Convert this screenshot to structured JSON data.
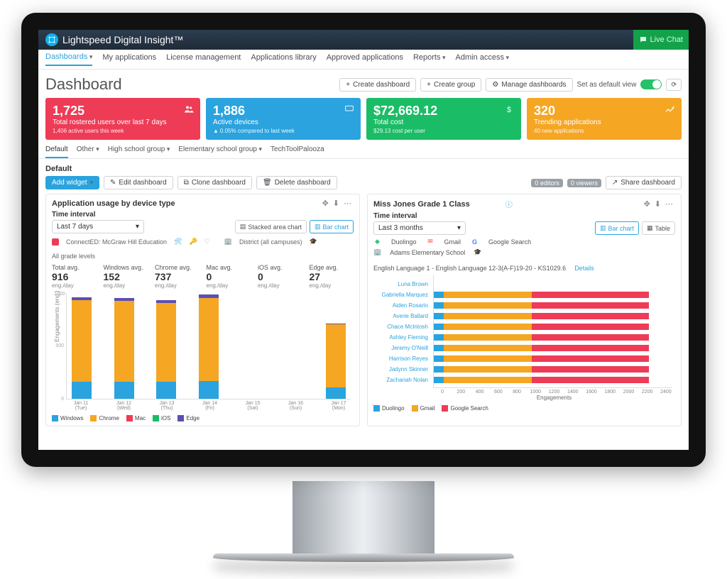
{
  "brand": "Lightspeed Digital Insight™",
  "live_chat": "Live Chat",
  "nav": [
    "Dashboards",
    "My applications",
    "License management",
    "Applications library",
    "Approved applications",
    "Reports",
    "Admin access"
  ],
  "page_title": "Dashboard",
  "actions": {
    "create_dashboard": "Create dashboard",
    "create_group": "Create group",
    "manage_dashboards": "Manage dashboards",
    "set_default": "Set as default view"
  },
  "kpis": [
    {
      "value": "1,725",
      "label": "Total rostered users over last 7 days",
      "sub": "1,406 active users this week"
    },
    {
      "value": "1,886",
      "label": "Active devices",
      "sub": "0.05% compared to last week"
    },
    {
      "value": "$72,669.12",
      "label": "Total cost",
      "sub": "$29.13 cost per user"
    },
    {
      "value": "320",
      "label": "Trending applications",
      "sub": "40 new applications"
    }
  ],
  "group_tabs": [
    "Default",
    "Other",
    "High school group",
    "Elementary school group",
    "TechToolPalooza"
  ],
  "section_label": "Default",
  "toolbar": {
    "add_widget": "Add widget",
    "edit": "Edit dashboard",
    "clone": "Clone dashboard",
    "delete": "Delete dashboard",
    "editors": "0 editors",
    "viewers": "0 viewers",
    "share": "Share dashboard"
  },
  "panel_left": {
    "title": "Application usage by device type",
    "time_label": "Time interval",
    "time_value": "Last 7 days",
    "view_stacked": "Stacked area chart",
    "view_bar": "Bar chart",
    "filter_app": "ConnectED: McGraw Hill Education",
    "filter_district": "District (all campuses)",
    "filter_grade": "All grade levels",
    "stats": [
      {
        "title": "Total avg.",
        "value": "916",
        "unit": "eng./day"
      },
      {
        "title": "Windows avg.",
        "value": "152",
        "unit": "eng./day"
      },
      {
        "title": "Chrome avg.",
        "value": "737",
        "unit": "eng./day"
      },
      {
        "title": "Mac avg.",
        "value": "0",
        "unit": "eng./day"
      },
      {
        "title": "iOS avg.",
        "value": "0",
        "unit": "eng./day"
      },
      {
        "title": "Edge avg.",
        "value": "27",
        "unit": "eng./day"
      }
    ],
    "ylabel": "Engagements (eng.)",
    "legend": [
      "Windows",
      "Chrome",
      "Mac",
      "iOS",
      "Edge"
    ]
  },
  "panel_right": {
    "title": "Miss Jones Grade 1 Class",
    "time_label": "Time interval",
    "time_value": "Last 3 months",
    "view_bar": "Bar chart",
    "view_table": "Table",
    "apps": [
      "Duolingo",
      "Gmail",
      "Google Search"
    ],
    "school": "Adams Elementary School",
    "course": "English Language 1 - English Language 12-3(A-F)19-20 - KS1029.6",
    "details": "Details",
    "xlabel": "Engagements"
  },
  "chart_data": [
    {
      "type": "bar",
      "panel": "left",
      "stacked": true,
      "categories": [
        "Jan 11 (Tue)",
        "Jan 12 (Wed)",
        "Jan 13 (Thu)",
        "Jan 14 (Fri)",
        "Jan 15 (Sat)",
        "Jan 16 (Sun)",
        "Jan 17 (Mon)"
      ],
      "series": [
        {
          "name": "Windows",
          "color": "#2aa3df",
          "values": [
            160,
            160,
            160,
            170,
            0,
            0,
            110
          ]
        },
        {
          "name": "Chrome",
          "color": "#f5a623",
          "values": [
            770,
            760,
            740,
            780,
            0,
            0,
            590
          ]
        },
        {
          "name": "Mac",
          "color": "#ee3b56",
          "values": [
            0,
            0,
            0,
            0,
            0,
            0,
            0
          ]
        },
        {
          "name": "iOS",
          "color": "#1bbc66",
          "values": [
            0,
            0,
            0,
            0,
            0,
            0,
            0
          ]
        },
        {
          "name": "Edge",
          "color": "#5a4fb5",
          "values": [
            25,
            30,
            25,
            30,
            0,
            0,
            10
          ]
        }
      ],
      "ylim": [
        0,
        1000
      ],
      "ylabel": "Engagements (eng.)"
    },
    {
      "type": "bar",
      "panel": "right",
      "orientation": "horizontal",
      "stacked": true,
      "categories": [
        "Luna Brown",
        "Gabriella Marquez",
        "Aiden Rosario",
        "Averie Ballard",
        "Chace McIntosh",
        "Ashley Fleming",
        "Jeremy O'Neill",
        "Harrison Reyes",
        "Jadynn Skinner",
        "Zachariah Nolan"
      ],
      "series": [
        {
          "name": "Duolingo",
          "color": "#2aa3df",
          "values": [
            0,
            100,
            100,
            100,
            100,
            100,
            100,
            100,
            100,
            100
          ]
        },
        {
          "name": "Gmail",
          "color": "#f5a623",
          "values": [
            0,
            900,
            900,
            900,
            900,
            900,
            900,
            900,
            900,
            900
          ]
        },
        {
          "name": "Google Search",
          "color": "#ee3b56",
          "values": [
            0,
            1200,
            1200,
            1200,
            1200,
            1200,
            1200,
            1200,
            1200,
            1200
          ]
        }
      ],
      "xlim": [
        0,
        2400
      ],
      "xlabel": "Engagements"
    }
  ]
}
